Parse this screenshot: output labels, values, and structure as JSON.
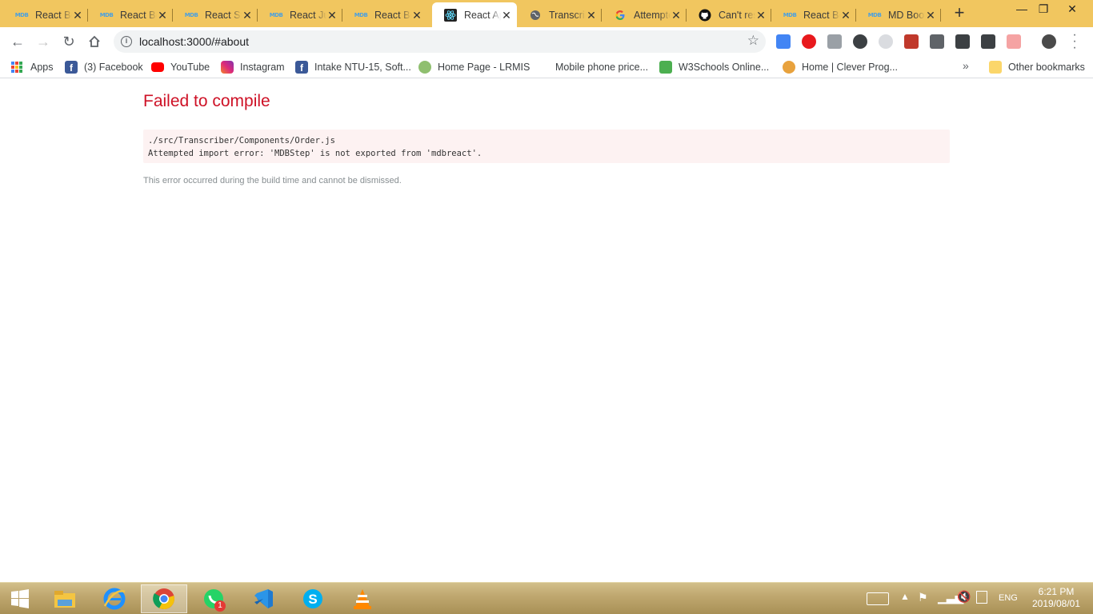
{
  "tabs": [
    {
      "title": "React Bootstrap",
      "favicon": "mdb-icon"
    },
    {
      "title": "React Bootstrap",
      "favicon": "mdb-icon"
    },
    {
      "title": "React Stepper",
      "favicon": "mdb-icon"
    },
    {
      "title": "React Jumbotron",
      "favicon": "mdb-icon"
    },
    {
      "title": "React Bootstrap",
      "favicon": "mdb-icon"
    },
    {
      "title": "React App",
      "favicon": "react-icon",
      "active": true
    },
    {
      "title": "Transcriber",
      "favicon": "globe-icon"
    },
    {
      "title": "Attempted import error",
      "favicon": "google-icon"
    },
    {
      "title": "Can't resolve",
      "favicon": "github-icon"
    },
    {
      "title": "React Bootstrap",
      "favicon": "mdb-icon"
    },
    {
      "title": "MD Bootstrap",
      "favicon": "mdb-icon"
    }
  ],
  "toolbar": {
    "url": "localhost:3000/#about"
  },
  "bookmarks": {
    "apps": "Apps",
    "items": [
      {
        "label": "(3) Facebook",
        "icon": "facebook-icon"
      },
      {
        "label": "YouTube",
        "icon": "youtube-icon"
      },
      {
        "label": "Instagram",
        "icon": "instagram-icon"
      },
      {
        "label": "Intake NTU-15, Soft...",
        "icon": "facebook-icon"
      },
      {
        "label": "Home Page - LRMIS",
        "icon": "lrmis-icon"
      },
      {
        "label": "Mobile phone price...",
        "icon": "blank-icon"
      },
      {
        "label": "W3Schools Online...",
        "icon": "w3schools-icon"
      },
      {
        "label": "Home | Clever Prog...",
        "icon": "clever-icon"
      }
    ],
    "other": "Other bookmarks"
  },
  "page": {
    "title": "Failed to compile",
    "error_line1": "./src/Transcriber/Components/Order.js",
    "error_line2": "Attempted import error: 'MDBStep' is not exported from 'mdbreact'.",
    "footer": "This error occurred during the build time and cannot be dismissed."
  },
  "taskbar": {
    "apps": [
      "file-explorer-icon",
      "internet-explorer-icon",
      "chrome-icon",
      "whatsapp-icon",
      "vscode-icon",
      "skype-icon",
      "vlc-icon"
    ],
    "whatsapp_badge": "1",
    "language": "ENG",
    "time": "6:21 PM",
    "date": "2019/08/01"
  },
  "colors": {
    "tabstrip": "#f1c65f",
    "error_title": "#ce1126",
    "error_box_bg": "#fdf2f2"
  }
}
